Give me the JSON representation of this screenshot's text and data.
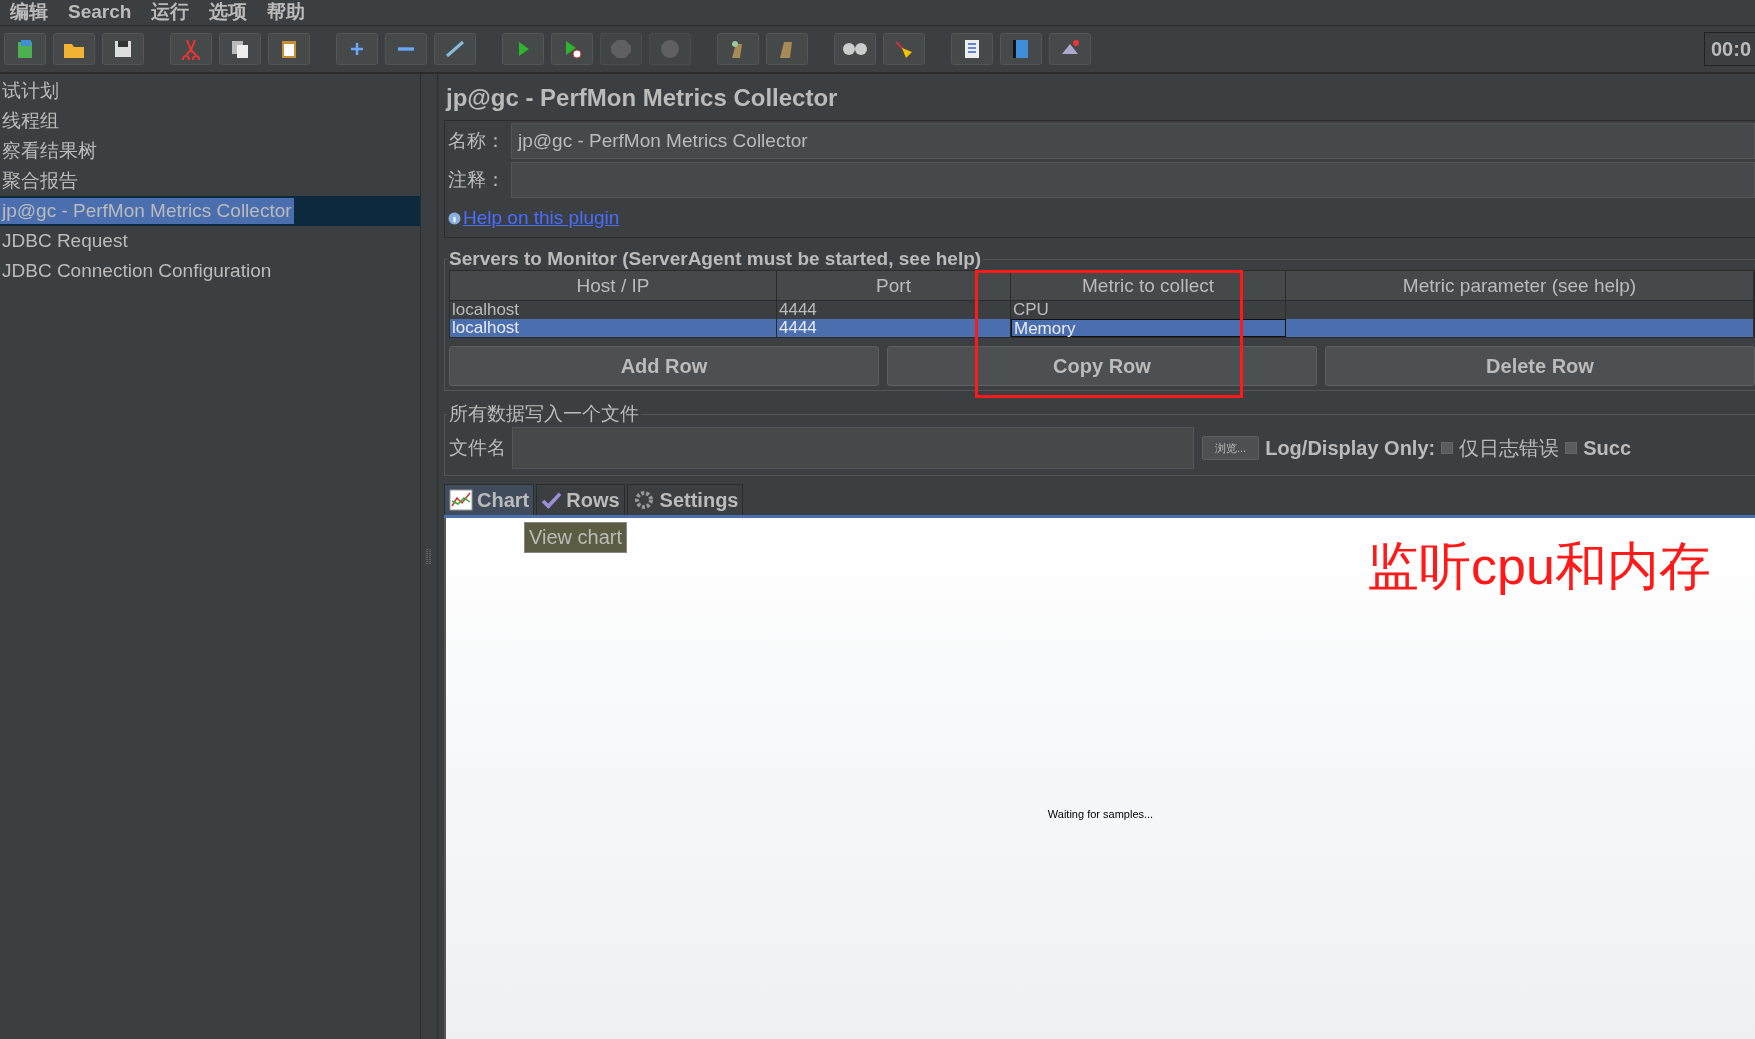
{
  "menu": [
    "编辑",
    "Search",
    "运行",
    "选项",
    "帮助"
  ],
  "clock": "00:0",
  "tree": [
    {
      "label": "试计划",
      "selected": false
    },
    {
      "label": "线程组",
      "selected": false
    },
    {
      "label": "察看结果树",
      "selected": false
    },
    {
      "label": "聚合报告",
      "selected": false
    },
    {
      "label": "jp@gc - PerfMon Metrics Collector",
      "selected": true
    },
    {
      "label": "JDBC Request",
      "selected": false
    },
    {
      "label": "JDBC Connection Configuration",
      "selected": false
    }
  ],
  "panel": {
    "title": "jp@gc - PerfMon Metrics Collector",
    "name_label": "名称：",
    "name_value": "jp@gc - PerfMon Metrics Collector",
    "comment_label": "注释：",
    "help_link": "Help on this plugin"
  },
  "servers": {
    "legend": "Servers to Monitor (ServerAgent must be started, see help)",
    "columns": [
      "Host / IP",
      "Port",
      "Metric to collect",
      "Metric parameter (see help)"
    ],
    "rows": [
      {
        "cells": [
          "localhost",
          "4444",
          "CPU",
          ""
        ],
        "selected": false
      },
      {
        "cells": [
          "localhost",
          "4444",
          "Memory",
          ""
        ],
        "selected": true
      }
    ],
    "buttons": [
      "Add Row",
      "Copy Row",
      "Delete Row"
    ]
  },
  "file": {
    "legend": "所有数据写入一个文件",
    "label": "文件名",
    "browse": "浏览...",
    "log_label": "Log/Display Only:",
    "options": [
      {
        "label": "仅日志错误",
        "checked": false
      },
      {
        "label": "Succ",
        "checked": false
      }
    ]
  },
  "tabs": [
    {
      "label": "Chart",
      "selected": true
    },
    {
      "label": "Rows",
      "selected": false
    },
    {
      "label": "Settings",
      "selected": false
    }
  ],
  "tooltip": "View chart",
  "chart_message": "Waiting for samples...",
  "annotation": "监听cpu和内存"
}
